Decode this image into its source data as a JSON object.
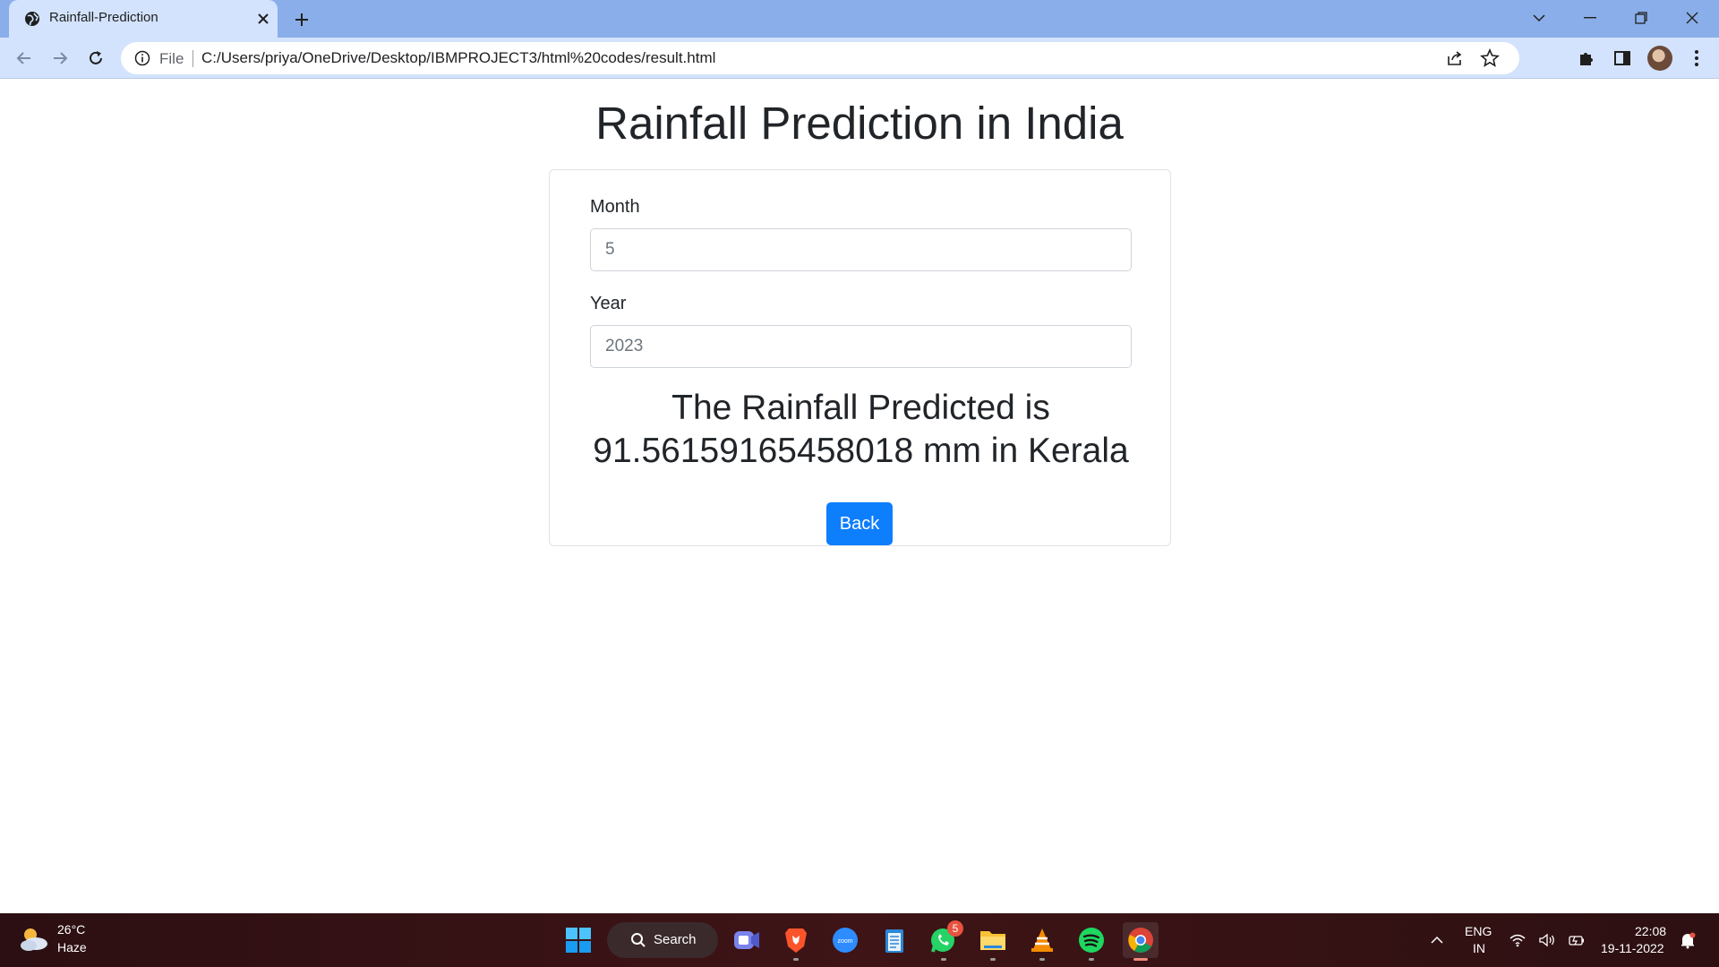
{
  "browser": {
    "tab_title": "Rainfall-Prediction",
    "file_chip": "File",
    "url": "C:/Users/priya/OneDrive/Desktop/IBMPROJECT3/html%20codes/result.html"
  },
  "page": {
    "title": "Rainfall Prediction in India",
    "month_label": "Month",
    "month_value": "5",
    "year_label": "Year",
    "year_value": "2023",
    "result_line1": "The Rainfall Predicted is",
    "result_line2": "91.56159165458018 mm in Kerala",
    "back_label": "Back"
  },
  "taskbar": {
    "weather_temp": "26°C",
    "weather_condition": "Haze",
    "search_label": "Search",
    "whatsapp_badge": "5",
    "lang_1": "ENG",
    "lang_2": "IN",
    "time": "22:08",
    "date": "19-11-2022"
  },
  "colors": {
    "tabstrip": "#8aaee9",
    "toolbar": "#d3e3fd",
    "primary_button": "#0d7efc",
    "taskbar": "#3e1416"
  }
}
